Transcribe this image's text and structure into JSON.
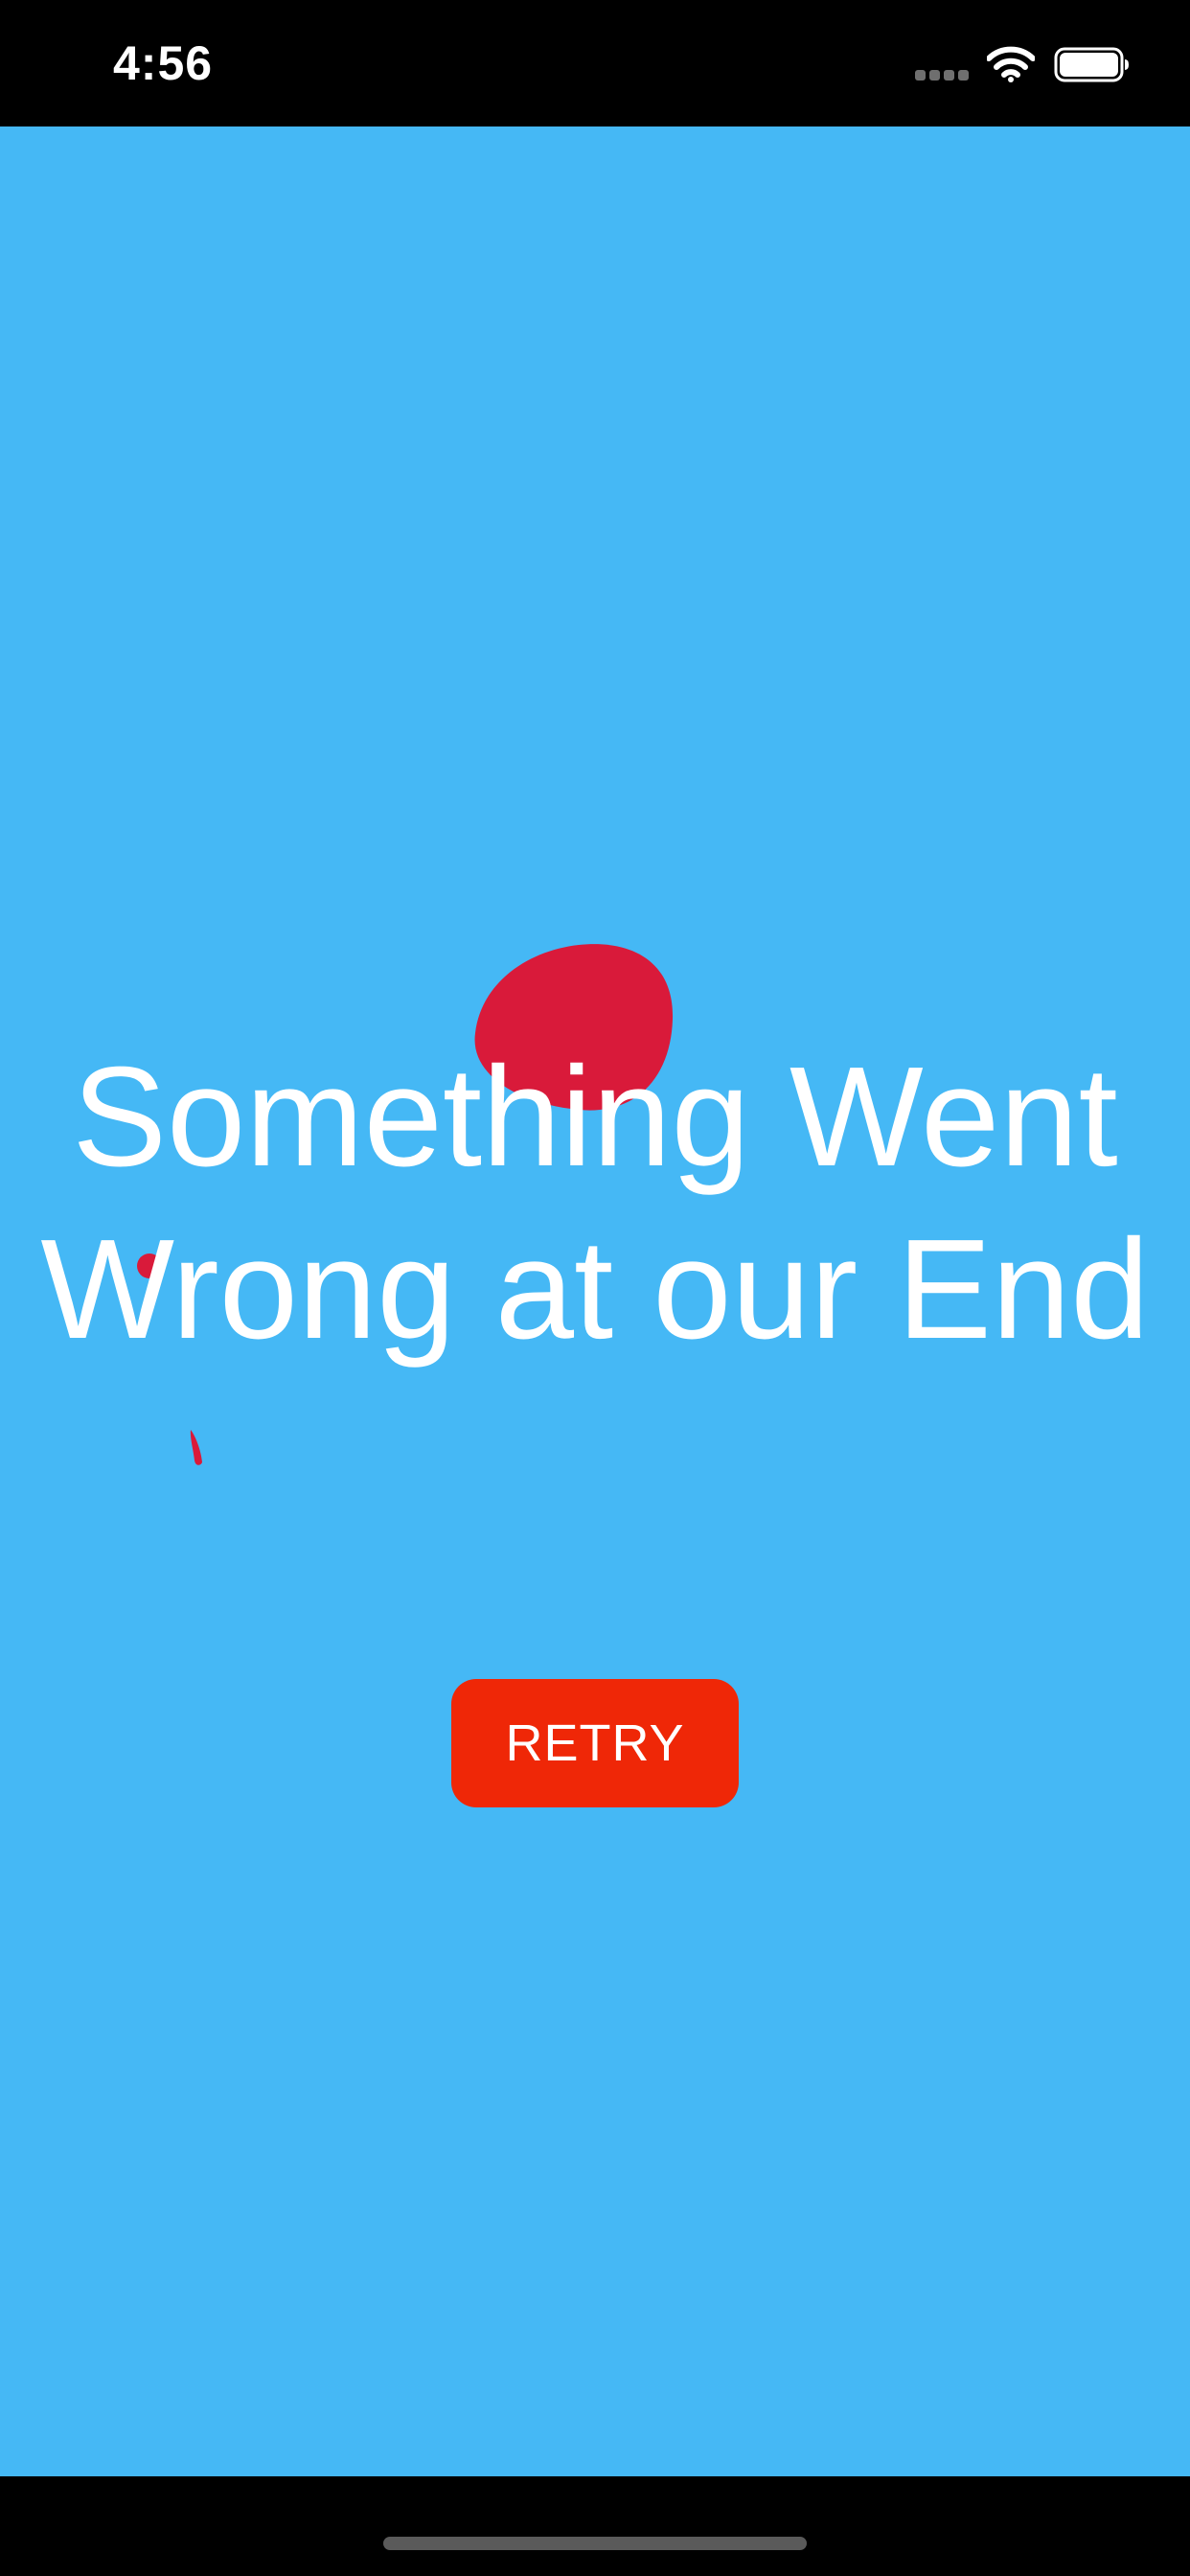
{
  "status_bar": {
    "time": "4:56",
    "icons": [
      "cellular-signal-icon",
      "wifi-icon",
      "battery-icon"
    ]
  },
  "error_screen": {
    "title": "Something Went Wrong at our End",
    "retry_label": "RETRY"
  },
  "colors": {
    "background": "#45b8f5",
    "title_text": "#ffffff",
    "retry_button": "#ef2707",
    "retry_text": "#ffffff",
    "decoration_red": "#d91a3a",
    "system_bars": "#000000"
  }
}
